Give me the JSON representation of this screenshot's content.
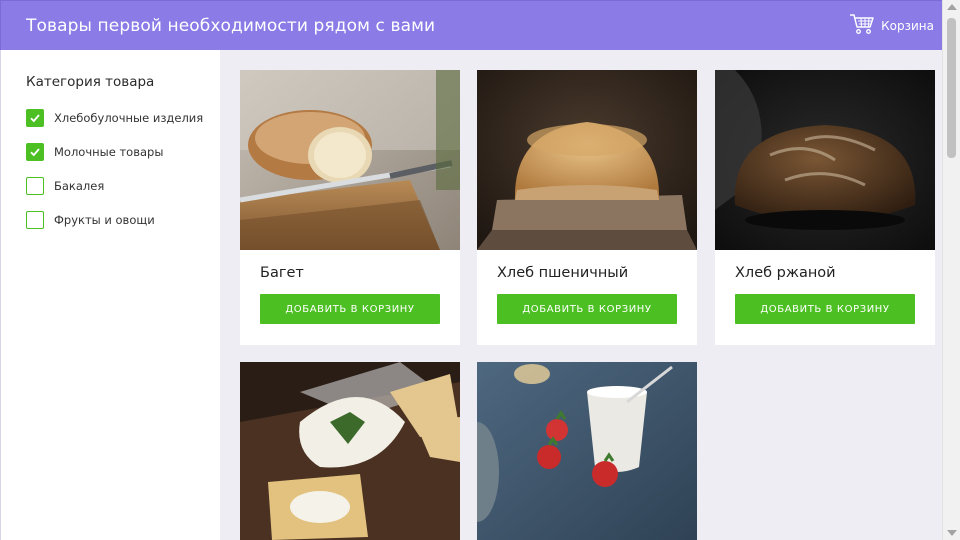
{
  "header": {
    "title": "Товары первой необходимости рядом с вами",
    "cart_label": "Корзина",
    "cart_icon": "shopping-cart-icon"
  },
  "sidebar": {
    "title": "Категория товара",
    "filters": [
      {
        "label": "Хлебобулочные изделия",
        "checked": true
      },
      {
        "label": "Молочные товары",
        "checked": true
      },
      {
        "label": "Бакалея",
        "checked": false
      },
      {
        "label": "Фрукты и овощи",
        "checked": false
      }
    ]
  },
  "products": [
    {
      "name": "Багет",
      "button": "ДОБАВИТЬ В КОРЗИНУ"
    },
    {
      "name": "Хлеб пшеничный",
      "button": "ДОБАВИТЬ В КОРЗИНУ"
    },
    {
      "name": "Хлеб ржаной",
      "button": "ДОБАВИТЬ В КОРЗИНУ"
    },
    {
      "name": "",
      "button": ""
    },
    {
      "name": "",
      "button": ""
    }
  ],
  "colors": {
    "header_bg": "#8a7be6",
    "accent_green": "#4cbf22",
    "content_bg": "#eeedf3"
  }
}
